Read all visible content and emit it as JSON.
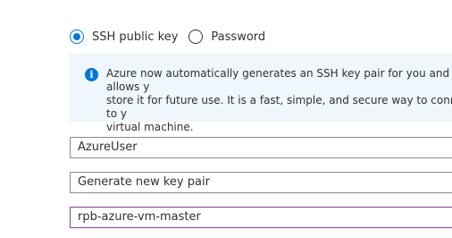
{
  "auth": {
    "options": [
      {
        "label": "SSH public key",
        "selected": true
      },
      {
        "label": "Password",
        "selected": false
      }
    ]
  },
  "info": {
    "icon": "info-icon",
    "glyph": "i",
    "text": "Azure now automatically generates an SSH key pair for you and allows y\nstore it for future use. It is a fast, simple, and secure way to connect to y\nvirtual machine."
  },
  "fields": {
    "username": {
      "value": "AzureUser"
    },
    "key_source": {
      "value": "Generate new key pair"
    },
    "key_pair_name": {
      "value": "rpb-azure-vm-master"
    }
  },
  "colors": {
    "accent": "#0078d4",
    "info_background": "#eff6fc",
    "border": "#8a8886",
    "focus_border": "#8a3d9c"
  }
}
